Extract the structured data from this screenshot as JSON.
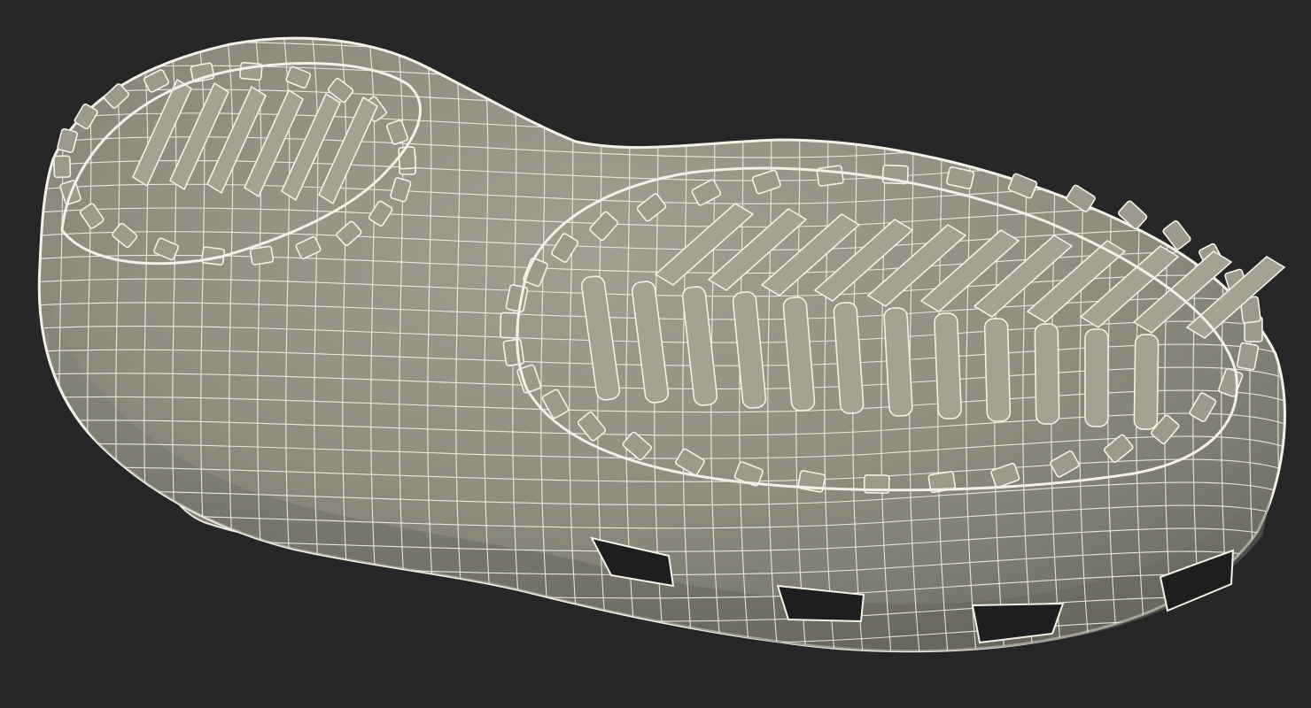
{
  "scene": {
    "subject": "clog-sole-wireframe-render",
    "background_color": "#262626",
    "mesh_fill_color": "#8e8d80",
    "mesh_shadow_color": "#6f6e63",
    "wire_color": "#f3f1e6"
  }
}
